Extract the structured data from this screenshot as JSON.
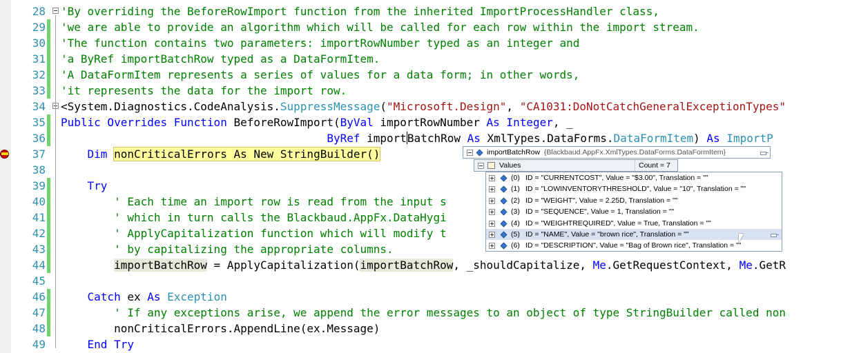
{
  "lines": [
    {
      "n": "28",
      "segs": [
        {
          "c": "cm",
          "t": "'By overriding the BeforeRowImport function from the inherited ImportProcessHandler class,"
        }
      ]
    },
    {
      "n": "29",
      "segs": [
        {
          "c": "cm",
          "t": "'we are able to provide an algorithm which will be called for each row within the import stream."
        }
      ]
    },
    {
      "n": "30",
      "segs": [
        {
          "c": "cm",
          "t": "'The function contains two parameters: importRowNumber typed as an integer and"
        }
      ]
    },
    {
      "n": "31",
      "segs": [
        {
          "c": "cm",
          "t": "'a ByRef importBatchRow typed as a DataFormItem."
        }
      ]
    },
    {
      "n": "32",
      "segs": [
        {
          "c": "cm",
          "t": "'A DataFormItem represents a series of values for a data form; in other words,"
        }
      ]
    },
    {
      "n": "33",
      "segs": [
        {
          "c": "cm",
          "t": "'it represents the data for the import row."
        }
      ]
    },
    {
      "n": "34",
      "segs": [
        {
          "c": "",
          "t": "<System.Diagnostics.CodeAnalysis."
        },
        {
          "c": "ty",
          "t": "SuppressMessage"
        },
        {
          "c": "",
          "t": "("
        },
        {
          "c": "st",
          "t": "\"Microsoft.Design\""
        },
        {
          "c": "",
          "t": ", "
        },
        {
          "c": "st",
          "t": "\"CA1031:DoNotCatchGeneralExceptionTypes\""
        }
      ]
    },
    {
      "n": "35",
      "segs": [
        {
          "c": "kw",
          "t": "Public Overrides Function"
        },
        {
          "c": "",
          "t": " BeforeRowImport("
        },
        {
          "c": "kw",
          "t": "ByVal"
        },
        {
          "c": "",
          "t": " importRowNumber "
        },
        {
          "c": "kw",
          "t": "As Integer"
        },
        {
          "c": "",
          "t": ", _"
        }
      ]
    },
    {
      "n": "36",
      "segs": [
        {
          "c": "kw",
          "t": "                                        ByRef"
        },
        {
          "c": "",
          "t": " import"
        },
        {
          "c": "caret",
          "t": ""
        },
        {
          "c": "",
          "t": "BatchRow "
        },
        {
          "c": "kw",
          "t": "As"
        },
        {
          "c": "",
          "t": " XmlTypes.DataForms."
        },
        {
          "c": "ty",
          "t": "DataFormItem"
        },
        {
          "c": "",
          "t": ") "
        },
        {
          "c": "kw",
          "t": "As"
        },
        {
          "c": "ty",
          "t": " ImportP"
        }
      ]
    },
    {
      "n": "37",
      "segs": [
        {
          "c": "kw",
          "t": "    Dim"
        },
        {
          "c": "",
          "t": " "
        },
        {
          "c": "hl",
          "t": "nonCriticalErrors As New StringBuilder()"
        }
      ]
    },
    {
      "n": "38",
      "segs": []
    },
    {
      "n": "39",
      "segs": [
        {
          "c": "kw",
          "t": "    Try"
        }
      ]
    },
    {
      "n": "40",
      "segs": [
        {
          "c": "cm",
          "t": "        ' Each time an import row is read from the input s"
        }
      ]
    },
    {
      "n": "41",
      "segs": [
        {
          "c": "cm",
          "t": "        ' which in turn calls the Blackbaud.AppFx.DataHygi"
        }
      ]
    },
    {
      "n": "42",
      "segs": [
        {
          "c": "cm",
          "t": "        ' ApplyCapitalization function which will modify t"
        }
      ]
    },
    {
      "n": "43",
      "segs": [
        {
          "c": "cm",
          "t": "        ' by capitalizing the appropriate columns."
        }
      ]
    },
    {
      "n": "44",
      "segs": [
        {
          "c": "",
          "t": "        "
        },
        {
          "c": "ref",
          "t": "importBatchRow"
        },
        {
          "c": "",
          "t": " = ApplyCapitalization("
        },
        {
          "c": "ref",
          "t": "importBatchRow"
        },
        {
          "c": "",
          "t": ", _shouldCapitalize, "
        },
        {
          "c": "kw",
          "t": "Me"
        },
        {
          "c": "",
          "t": ".GetRequestContext, "
        },
        {
          "c": "kw",
          "t": "Me"
        },
        {
          "c": "",
          "t": ".GetR"
        }
      ]
    },
    {
      "n": "45",
      "segs": []
    },
    {
      "n": "46",
      "segs": [
        {
          "c": "kw",
          "t": "    Catch"
        },
        {
          "c": "",
          "t": " ex "
        },
        {
          "c": "kw",
          "t": "As"
        },
        {
          "c": "ty",
          "t": " Exception"
        }
      ]
    },
    {
      "n": "47",
      "segs": [
        {
          "c": "cm",
          "t": "        ' If any exceptions arise, we append the error messages to an object of type StringBuilder called non"
        }
      ]
    },
    {
      "n": "48",
      "segs": [
        {
          "c": "",
          "t": "        nonCriticalErrors.AppendLine(ex.Message)"
        }
      ]
    },
    {
      "n": "49",
      "segs": [
        {
          "c": "kw",
          "t": "    End Try"
        }
      ]
    }
  ],
  "datatip": {
    "root_name": "importBatchRow",
    "root_type": "{Blackbaud.AppFx.XmlTypes.DataForms.DataFormItem}",
    "values_label": "Values",
    "values_count": "Count = 7",
    "items": [
      {
        "idx": "(0)",
        "text": "ID = \"CURRENTCOST\", Value = \"$3.00\", Translation = \"\""
      },
      {
        "idx": "(1)",
        "text": "ID = \"LOWINVENTORYTHRESHOLD\", Value = \"10\", Translation = \"\""
      },
      {
        "idx": "(2)",
        "text": "ID = \"WEIGHT\", Value = 2.25D, Translation = \"\""
      },
      {
        "idx": "(3)",
        "text": "ID = \"SEQUENCE\", Value = 1, Translation = \"\""
      },
      {
        "idx": "(4)",
        "text": "ID = \"WEIGHTREQUIRED\", Value = True, Translation = \"\""
      },
      {
        "idx": "(5)",
        "text": "ID = \"NAME\", Value = \"brown rice\", Translation = \"\""
      },
      {
        "idx": "(6)",
        "text": "ID = \"DESCRIPTION\", Value = \"Bag of Brown rice\", Translation = \"\""
      }
    ],
    "selected_index": 5
  },
  "colors": {
    "comment": "#008000",
    "keyword": "#0000ff",
    "string": "#a31515",
    "type": "#2b91af",
    "line_number": "#2b91af",
    "change_bar": "#6fd36f"
  }
}
